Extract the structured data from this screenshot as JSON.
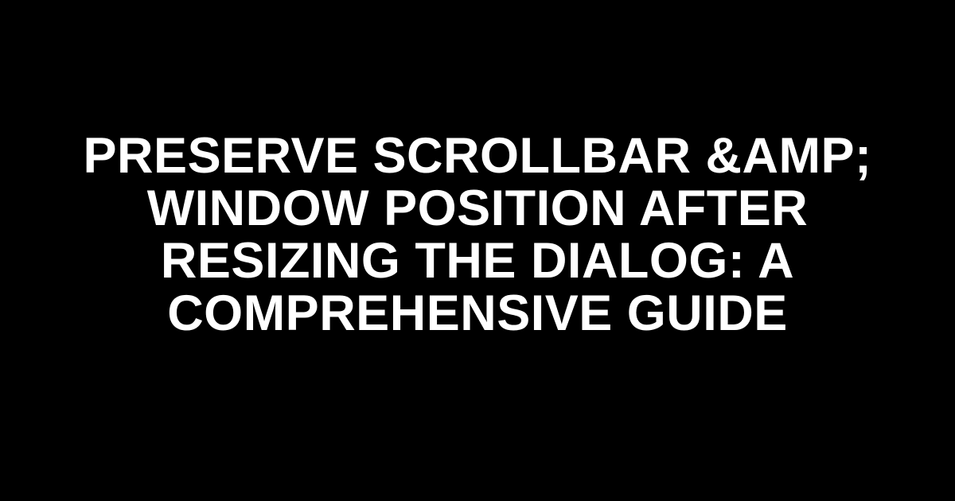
{
  "title": "PRESERVE SCROLLBAR &AMP; WINDOW POSITION AFTER RESIZING THE DIALOG: A COMPREHENSIVE GUIDE"
}
